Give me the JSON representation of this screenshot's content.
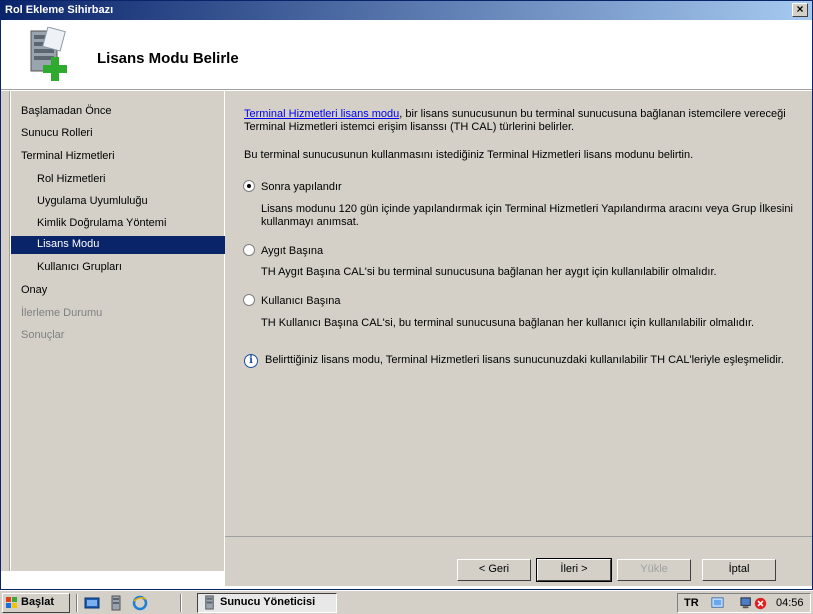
{
  "window": {
    "title": "Rol Ekleme Sihirbazı",
    "close_glyph": "×"
  },
  "header": {
    "title": "Lisans Modu Belirle",
    "icon": "server-add-icon"
  },
  "nav": {
    "items": [
      {
        "label": "Başlamadan Önce",
        "level": 0,
        "state": "normal"
      },
      {
        "label": "Sunucu Rolleri",
        "level": 0,
        "state": "normal"
      },
      {
        "label": "Terminal Hizmetleri",
        "level": 0,
        "state": "normal"
      },
      {
        "label": "Rol Hizmetleri",
        "level": 1,
        "state": "normal"
      },
      {
        "label": "Uygulama Uyumluluğu",
        "level": 1,
        "state": "normal"
      },
      {
        "label": "Kimlik Doğrulama Yöntemi",
        "level": 1,
        "state": "normal"
      },
      {
        "label": "Lisans Modu",
        "level": 1,
        "state": "active"
      },
      {
        "label": "Kullanıcı Grupları",
        "level": 1,
        "state": "normal"
      },
      {
        "label": "Onay",
        "level": 0,
        "state": "normal"
      },
      {
        "label": "İlerleme Durumu",
        "level": 0,
        "state": "disabled"
      },
      {
        "label": "Sonuçlar",
        "level": 0,
        "state": "disabled"
      }
    ]
  },
  "content": {
    "intro_link": "Terminal Hizmetleri lisans modu",
    "intro_rest": ", bir lisans sunucusunun bu terminal sunucusuna bağlanan istemcilere vereceği Terminal Hizmetleri istemci erişim lisanssı (TH CAL) türlerini belirler.",
    "instruction": "Bu terminal sunucusunun kullanmasını istediğiniz Terminal Hizmetleri lisans modunu belirtin.",
    "options": [
      {
        "label": "Sonra yapılandır",
        "checked": true,
        "description": "Lisans modunu 120 gün içinde yapılandırmak için Terminal Hizmetleri Yapılandırma aracını veya Grup İlkesini kullanmayı anımsat."
      },
      {
        "label": "Aygıt Başına",
        "checked": false,
        "description": "TH Aygıt Başına CAL'si bu terminal sunucusuna bağlanan her aygıt için kullanılabilir olmalıdır."
      },
      {
        "label": "Kullanıcı Başına",
        "checked": false,
        "description": "TH Kullanıcı Başına CAL'si, bu terminal sunucusuna bağlanan her kullanıcı için kullanılabilir olmalıdır."
      }
    ],
    "info_glyph": "i",
    "info_text": "Belirttiğiniz lisans modu, Terminal Hizmetleri lisans sunucunuzdaki kullanılabilir TH CAL'leriyle eşleşmelidir."
  },
  "buttons": {
    "back": "< Geri",
    "next": "İleri >",
    "install": "Yükle",
    "cancel": "İptal"
  },
  "taskbar": {
    "start": "Başlat",
    "task": "Sunucu Yöneticisi",
    "lang": "TR",
    "time": "04:56"
  },
  "colors": {
    "title_start": "#0a246a",
    "title_end": "#a6caf0",
    "nav_active": "#0a246a",
    "panel": "#d4d0c8",
    "link": "#0000ee"
  }
}
